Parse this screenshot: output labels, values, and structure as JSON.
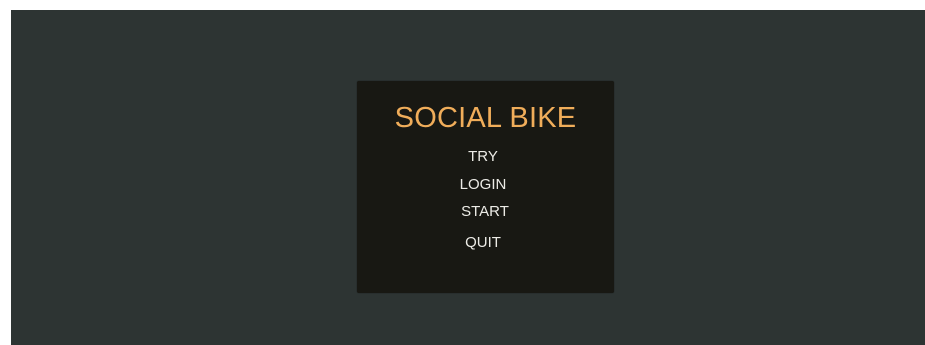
{
  "menu": {
    "title": "SOCIAL BIKE",
    "items": [
      {
        "label": "TRY"
      },
      {
        "label": "LOGIN"
      },
      {
        "label": "START"
      },
      {
        "label": "QUIT"
      }
    ]
  },
  "colors": {
    "background": "#2d3433",
    "panel": "#181813",
    "title": "#f0ad5a",
    "item_text": "#ecebe6"
  }
}
